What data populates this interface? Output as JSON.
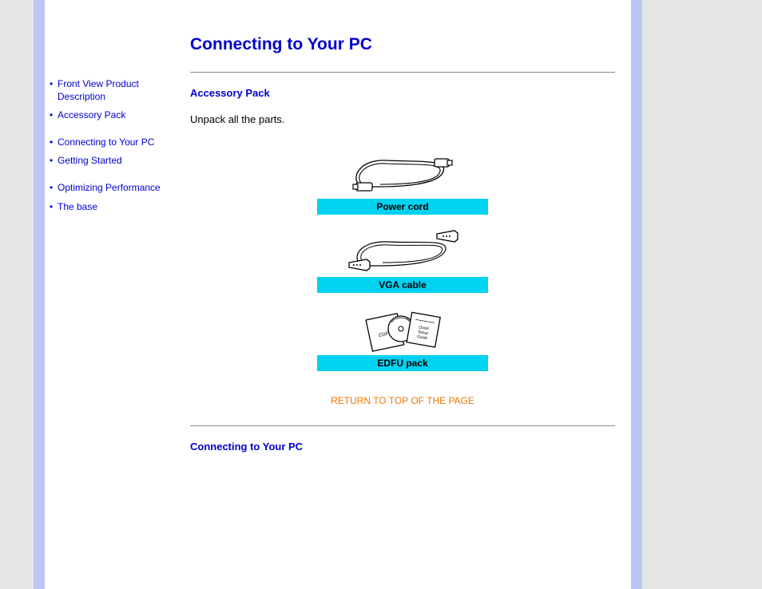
{
  "sidebar": {
    "items": [
      {
        "label": "Front View Product Description"
      },
      {
        "label": "Accessory Pack"
      },
      {
        "label": "Connecting to Your PC"
      },
      {
        "label": "Getting Started"
      },
      {
        "label": "Optimizing Performance"
      },
      {
        "label": "The base"
      }
    ]
  },
  "page": {
    "title": "Connecting to Your PC"
  },
  "section1": {
    "heading": "Accessory Pack",
    "body": "Unpack all the parts."
  },
  "accessories": {
    "items": [
      {
        "caption": "Power cord"
      },
      {
        "caption": "VGA cable"
      },
      {
        "caption": "EDFU pack"
      }
    ]
  },
  "return_link": "RETURN TO TOP OF THE PAGE",
  "section2": {
    "heading": "Connecting to Your PC"
  }
}
